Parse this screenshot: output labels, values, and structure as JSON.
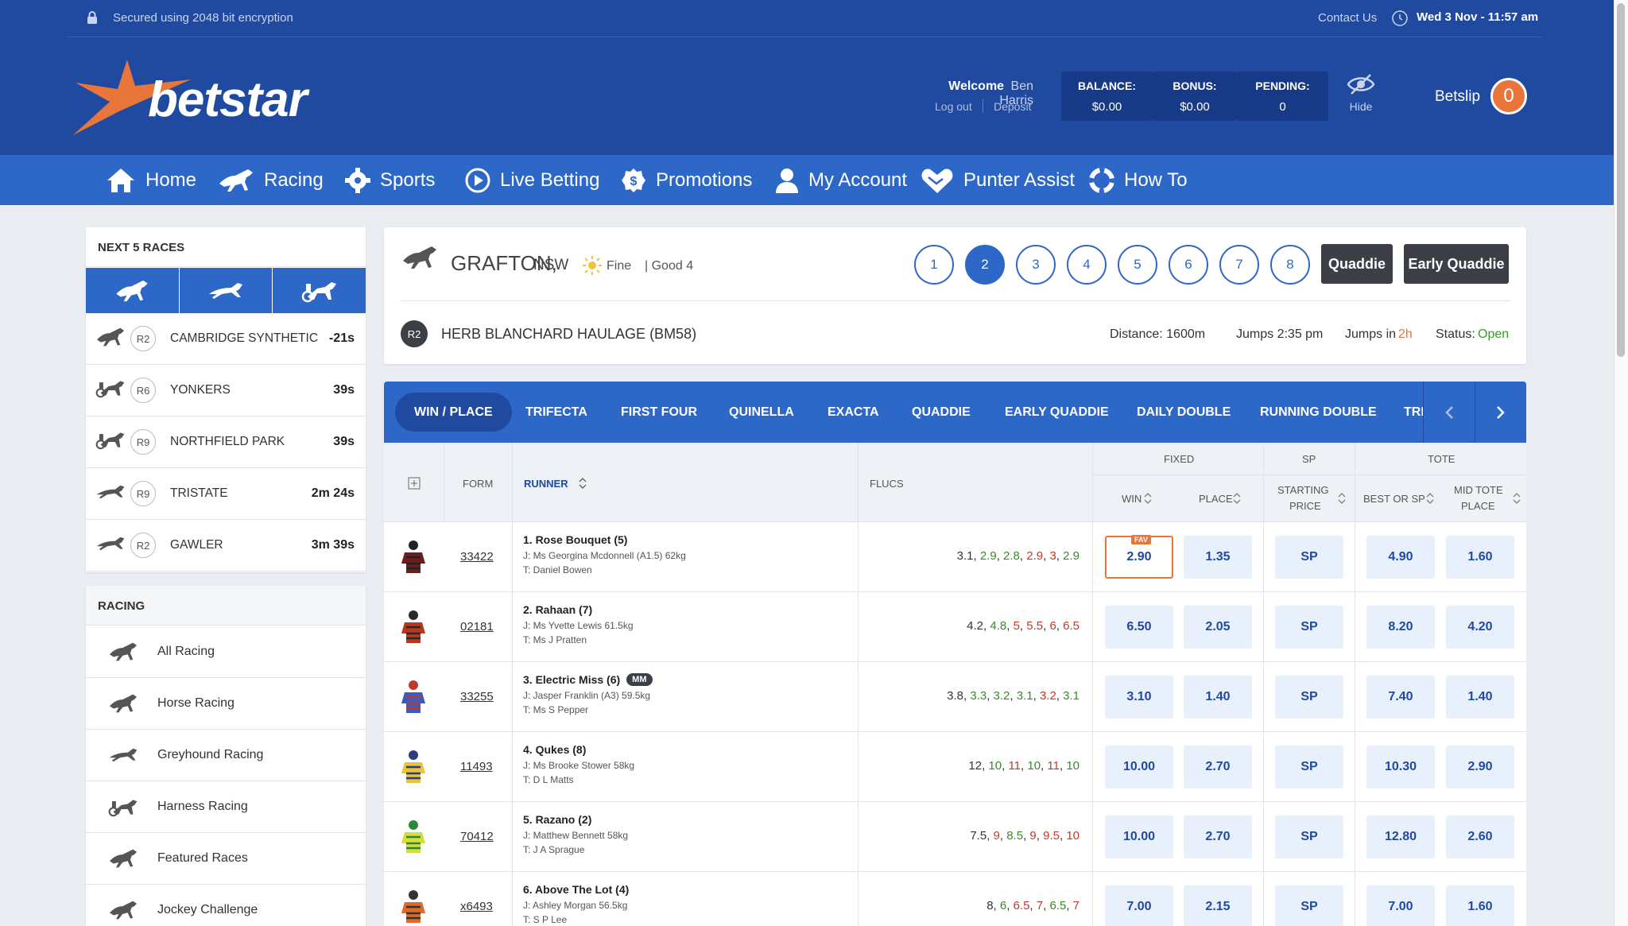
{
  "header": {
    "security_text": "Secured using 2048 bit encryption",
    "contact_link": "Contact Us",
    "datetime": "Wed 3 Nov - 11:57 am",
    "logo_text": "betstar",
    "welcome_label": "Welcome",
    "user_name": "Ben Harris",
    "logout_link": "Log out",
    "deposit_link": "Deposit",
    "balance": {
      "label": "BALANCE:",
      "value": "$0.00"
    },
    "bonus": {
      "label": "BONUS:",
      "value": "$0.00"
    },
    "pending": {
      "label": "PENDING:",
      "value": "0"
    },
    "hide_label": "Hide",
    "betslip_label": "Betslip",
    "betslip_count": "0"
  },
  "nav": [
    {
      "label": "Home",
      "icon": "home-icon"
    },
    {
      "label": "Racing",
      "icon": "horse-icon"
    },
    {
      "label": "Sports",
      "icon": "gear-icon"
    },
    {
      "label": "Live Betting",
      "icon": "play-icon"
    },
    {
      "label": "Promotions",
      "icon": "dollar-badge-icon"
    },
    {
      "label": "My Account",
      "icon": "user-icon"
    },
    {
      "label": "Punter Assist",
      "icon": "heart-hands-icon"
    },
    {
      "label": "How To",
      "icon": "lifebuoy-icon"
    }
  ],
  "next_races": {
    "title": "NEXT 5 RACES",
    "filters": [
      "horse-icon",
      "greyhound-icon",
      "harness-icon"
    ],
    "items": [
      {
        "icon": "horse-icon",
        "race": "R2",
        "name": "CAMBRIDGE SYNTHETIC",
        "time": "-21s"
      },
      {
        "icon": "harness-icon",
        "race": "R6",
        "name": "YONKERS",
        "time": "39s"
      },
      {
        "icon": "harness-icon",
        "race": "R9",
        "name": "NORTHFIELD PARK",
        "time": "39s"
      },
      {
        "icon": "greyhound-icon",
        "race": "R9",
        "name": "TRISTATE",
        "time": "2m 24s"
      },
      {
        "icon": "greyhound-icon",
        "race": "R2",
        "name": "GAWLER",
        "time": "3m 39s"
      }
    ]
  },
  "racing_menu": {
    "title": "RACING",
    "items": [
      {
        "icon": "horse-icon",
        "label": "All Racing"
      },
      {
        "icon": "horse-icon",
        "label": "Horse Racing"
      },
      {
        "icon": "greyhound-icon",
        "label": "Greyhound Racing"
      },
      {
        "icon": "harness-icon",
        "label": "Harness Racing"
      },
      {
        "icon": "horse-icon",
        "label": "Featured Races"
      },
      {
        "icon": "horse-icon",
        "label": "Jockey Challenge"
      }
    ]
  },
  "meeting": {
    "venue": "GRAFTON,",
    "state": "NSW",
    "weather": "Fine",
    "track": "| Good 4",
    "race_numbers": [
      "1",
      "2",
      "3",
      "4",
      "5",
      "6",
      "7",
      "8"
    ],
    "active_race": "2",
    "quaddie_label": "Quaddie",
    "early_quaddie_label": "Early Quaddie",
    "race_badge": "R2",
    "race_name": "HERB BLANCHARD HAULAGE (BM58)",
    "distance": "Distance: 1600m",
    "jumps_at": "Jumps 2:35 pm",
    "jumps_in_label": "Jumps in",
    "jumps_in_value": "2h",
    "status_label": "Status:",
    "status_value": "Open"
  },
  "bet_tabs": [
    "WIN / PLACE",
    "TRIFECTA",
    "FIRST FOUR",
    "QUINELLA",
    "EXACTA",
    "QUADDIE",
    "EARLY QUADDIE",
    "DAILY DOUBLE",
    "RUNNING DOUBLE",
    "TRI"
  ],
  "table": {
    "headers": {
      "form": "FORM",
      "runner": "RUNNER",
      "flucs": "FLUCS",
      "fixed": "FIXED",
      "sp": "SP",
      "tote": "TOTE",
      "win": "WIN",
      "place": "PLACE",
      "starting": "STARTING",
      "price": "PRICE",
      "best": "BEST OR SP",
      "mid": "MID TOTE",
      "mid2": "PLACE"
    },
    "fav_label": "FAV",
    "mm_label": "MM",
    "runners": [
      {
        "form": "33422",
        "name": "1. Rose Bouquet (5)",
        "jockey": "J: Ms Georgina Mcdonnell (A1.5) 62kg",
        "trainer": "T: Daniel Bowen",
        "flucs": [
          [
            "3.1",
            "n"
          ],
          [
            "2.9",
            "g"
          ],
          [
            "2.8",
            "g"
          ],
          [
            "2.9",
            "r"
          ],
          [
            "3",
            "r"
          ],
          [
            "2.9",
            "g"
          ]
        ],
        "win": "2.90",
        "place": "1.35",
        "sp": "SP",
        "best": "4.90",
        "mid": "1.60",
        "fav": true,
        "mm": false,
        "silk": [
          "#6b1e1e",
          "#222"
        ]
      },
      {
        "form": "02181",
        "name": "2. Rahaan (7)",
        "jockey": "J: Ms Yvette Lewis 61.5kg",
        "trainer": "T: Ms J Pratten",
        "flucs": [
          [
            "4.2",
            "n"
          ],
          [
            "4.8",
            "g"
          ],
          [
            "5",
            "r"
          ],
          [
            "5.5",
            "r"
          ],
          [
            "6",
            "r"
          ],
          [
            "6.5",
            "r"
          ]
        ],
        "win": "6.50",
        "place": "2.05",
        "sp": "SP",
        "best": "8.20",
        "mid": "4.20",
        "fav": false,
        "mm": false,
        "silk": [
          "#b8371f",
          "#2a2a2a"
        ]
      },
      {
        "form": "33255",
        "name": "3. Electric Miss (6)",
        "jockey": "J: Jasper Franklin (A3) 59.5kg",
        "trainer": "T: Ms S Pepper",
        "flucs": [
          [
            "3.8",
            "n"
          ],
          [
            "3.3",
            "g"
          ],
          [
            "3.2",
            "g"
          ],
          [
            "3.1",
            "g"
          ],
          [
            "3.2",
            "r"
          ],
          [
            "3.1",
            "g"
          ]
        ],
        "win": "3.10",
        "place": "1.40",
        "sp": "SP",
        "best": "7.40",
        "mid": "1.40",
        "fav": false,
        "mm": true,
        "silk": [
          "#3b5bc4",
          "#c0392b"
        ]
      },
      {
        "form": "11493",
        "name": "4. Qukes (8)",
        "jockey": "J: Ms Brooke Stower 58kg",
        "trainer": "T: D L Matts",
        "flucs": [
          [
            "12",
            "n"
          ],
          [
            "10",
            "g"
          ],
          [
            "11",
            "r"
          ],
          [
            "10",
            "g"
          ],
          [
            "11",
            "r"
          ],
          [
            "10",
            "g"
          ]
        ],
        "win": "10.00",
        "place": "2.70",
        "sp": "SP",
        "best": "10.30",
        "mid": "2.90",
        "fav": false,
        "mm": false,
        "silk": [
          "#e7c43a",
          "#2c3e80"
        ]
      },
      {
        "form": "70412",
        "name": "5. Razano (2)",
        "jockey": "J: Matthew Bennett 58kg",
        "trainer": "T: J A Sprague",
        "flucs": [
          [
            "7.5",
            "n"
          ],
          [
            "9",
            "r"
          ],
          [
            "8.5",
            "g"
          ],
          [
            "9",
            "r"
          ],
          [
            "9.5",
            "r"
          ],
          [
            "10",
            "r"
          ]
        ],
        "win": "10.00",
        "place": "2.70",
        "sp": "SP",
        "best": "12.80",
        "mid": "2.60",
        "fav": false,
        "mm": false,
        "silk": [
          "#d6dc3a",
          "#2a8a3a"
        ]
      },
      {
        "form": "x6493",
        "name": "6. Above The Lot (4)",
        "jockey": "J: Ashley Morgan 56.5kg",
        "trainer": "T: S P Lee",
        "flucs": [
          [
            "8",
            "n"
          ],
          [
            "6",
            "g"
          ],
          [
            "6.5",
            "r"
          ],
          [
            "7",
            "r"
          ],
          [
            "6.5",
            "g"
          ],
          [
            "7",
            "r"
          ]
        ],
        "win": "7.00",
        "place": "2.15",
        "sp": "SP",
        "best": "7.00",
        "mid": "1.60",
        "fav": false,
        "mm": false,
        "silk": [
          "#e06a2a",
          "#333"
        ]
      }
    ]
  },
  "colors": {
    "header": "#1f4aa0",
    "nav": "#2d68c8",
    "accent": "#e8753a",
    "up": "#c0392b",
    "down": "#3a8a2a",
    "open": "#3a9a2a"
  }
}
